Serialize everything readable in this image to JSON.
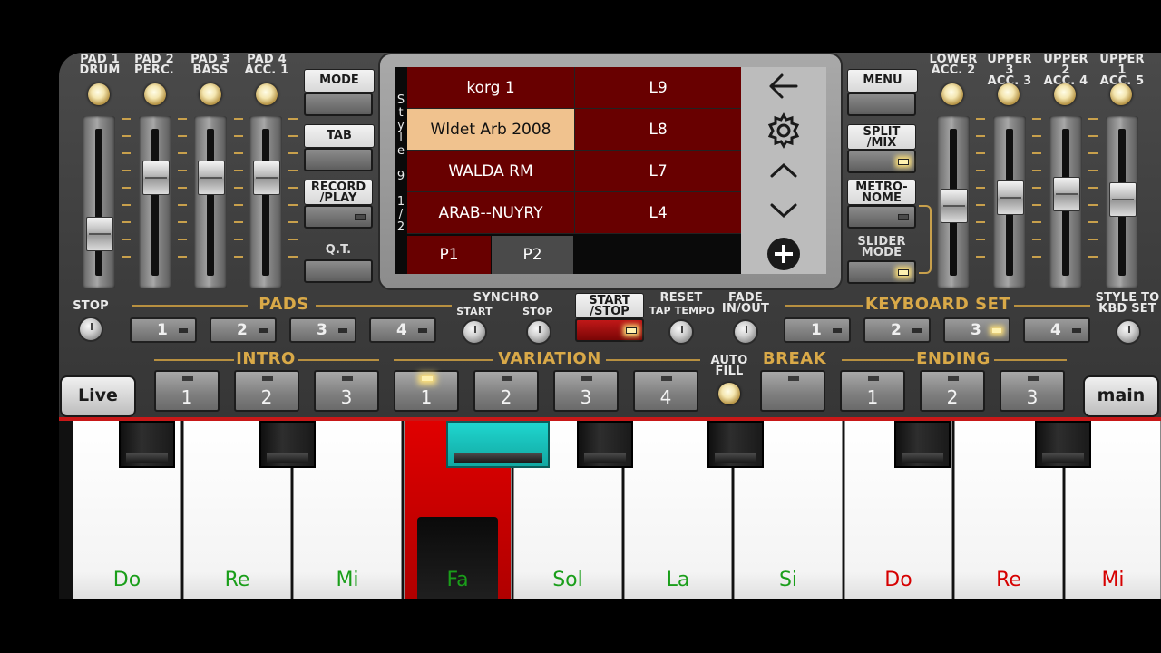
{
  "pads": [
    {
      "line1": "PAD 1",
      "line2": "DRUM"
    },
    {
      "line1": "PAD 2",
      "line2": "PERC."
    },
    {
      "line1": "PAD 3",
      "line2": "BASS"
    },
    {
      "line1": "PAD 4",
      "line2": "ACC. 1"
    }
  ],
  "right_channels": [
    {
      "line1": "LOWER",
      "line2": "ACC. 2"
    },
    {
      "line1": "UPPER 3",
      "line2": "ACC. 3"
    },
    {
      "line1": "UPPER 2",
      "line2": "ACC. 4"
    },
    {
      "line1": "UPPER 1",
      "line2": "ACC. 5"
    }
  ],
  "left_sliders": [
    0.23,
    0.72,
    0.72,
    0.72
  ],
  "right_sliders": [
    0.48,
    0.55,
    0.58,
    0.53
  ],
  "left_buttons": {
    "mode": "MODE",
    "tab": "TAB",
    "record_l1": "RECORD",
    "record_l2": "/PLAY",
    "qt": "Q.T."
  },
  "right_buttons": {
    "menu": "MENU",
    "split_l1": "SPLIT",
    "split_l2": "/MIX",
    "metro_l1": "METRO-",
    "metro_l2": "NOME",
    "slider_l1": "SLIDER",
    "slider_l2": "MODE"
  },
  "screen": {
    "side_label": [
      "S",
      "t",
      "y",
      "l",
      "e",
      "",
      "9",
      "",
      "1",
      "/",
      "2"
    ],
    "rows": [
      {
        "name": "korg 1",
        "slot": "L9",
        "selected": false
      },
      {
        "name": "Wldet Arb 2008",
        "slot": "L8",
        "selected": true
      },
      {
        "name": "WALDA   RM",
        "slot": "L7",
        "selected": false
      },
      {
        "name": "ARAB--NUYRY",
        "slot": "L4",
        "selected": false
      }
    ],
    "pages": [
      "P1",
      "P2"
    ],
    "nav_icons": [
      "back-arrow-icon",
      "settings-gear-icon",
      "chevron-up-icon",
      "chevron-down-icon",
      "add-circle-icon"
    ]
  },
  "controls": {
    "stop": "STOP",
    "pads": "PADS",
    "synchro": "SYNCHRO",
    "synchro_start": "START",
    "synchro_stop": "STOP",
    "start_l1": "START",
    "start_l2": "/STOP",
    "reset": "RESET",
    "tap_tempo": "TAP TEMPO",
    "fade_l1": "FADE",
    "fade_l2": "IN/OUT",
    "keyboard_set": "KEYBOARD SET",
    "style_l1": "STYLE TO",
    "style_l2": "KBD SET",
    "pad_numbers": [
      "1",
      "2",
      "3",
      "4"
    ],
    "kbd_numbers": [
      "1",
      "2",
      "3",
      "4"
    ]
  },
  "sections": {
    "intro": "INTRO",
    "variation": "VARIATION",
    "auto_l1": "AUTO",
    "auto_l2": "FILL",
    "break": "BREAK",
    "ending": "ENDING",
    "intro_numbers": [
      "1",
      "2",
      "3"
    ],
    "variation_numbers": [
      "1",
      "2",
      "3",
      "4"
    ],
    "ending_numbers": [
      "1",
      "2",
      "3"
    ],
    "live": "Live",
    "main": "main"
  },
  "keys": [
    {
      "name": "Do",
      "color": "#1a9e1a",
      "pressed": false
    },
    {
      "name": "Re",
      "color": "#1a9e1a",
      "pressed": false
    },
    {
      "name": "Mi",
      "color": "#1a9e1a",
      "pressed": false
    },
    {
      "name": "Fa",
      "color": "#1a9e1a",
      "pressed": true
    },
    {
      "name": "Sol",
      "color": "#1a9e1a",
      "pressed": false
    },
    {
      "name": "La",
      "color": "#1a9e1a",
      "pressed": false
    },
    {
      "name": "Si",
      "color": "#1a9e1a",
      "pressed": false
    },
    {
      "name": "Do",
      "color": "#d60000",
      "pressed": false
    },
    {
      "name": "Re",
      "color": "#d60000",
      "pressed": false
    },
    {
      "name": "Mi",
      "color": "#d60000",
      "pressed": false
    }
  ],
  "colors": {
    "gold": "#d9a948",
    "selected_row": "#f0c28e",
    "row": "#680000",
    "key_pressed": "#e00000",
    "black_key_active": "#1fd6cf"
  }
}
